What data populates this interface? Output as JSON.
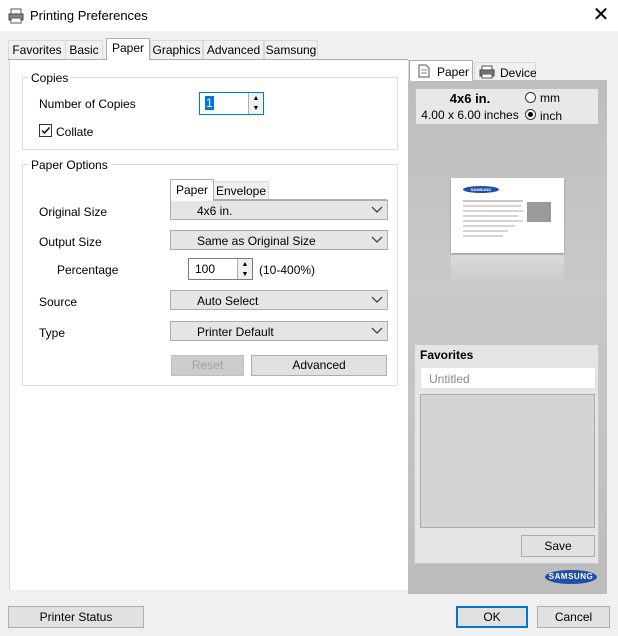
{
  "window": {
    "title": "Printing Preferences"
  },
  "tabs": [
    "Favorites",
    "Basic",
    "Paper",
    "Graphics",
    "Advanced",
    "Samsung"
  ],
  "copies": {
    "legend": "Copies",
    "number_label": "Number of Copies",
    "number_value": "1",
    "collate_label": "Collate",
    "collate_checked": true
  },
  "paper_options": {
    "legend": "Paper Options",
    "subtabs": [
      "Paper",
      "Envelope"
    ],
    "original_size_label": "Original Size",
    "original_size_value": "4x6 in.",
    "output_size_label": "Output Size",
    "output_size_value": "Same as Original Size",
    "percentage_label": "Percentage",
    "percentage_value": "100",
    "percentage_range": "(10-400%)",
    "source_label": "Source",
    "source_value": "Auto Select",
    "type_label": "Type",
    "type_value": "Printer Default",
    "reset_label": "Reset",
    "advanced_label": "Advanced"
  },
  "preview": {
    "tabs": [
      "Paper",
      "Device"
    ],
    "size_name": "4x6 in.",
    "size_dims": "4.00 x 6.00 inches",
    "unit_mm": "mm",
    "unit_inch": "inch",
    "selected_unit": "inch",
    "thumb_brand": "SAMSUNG",
    "favorites_title": "Favorites",
    "favorites_placeholder": "Untitled",
    "save_label": "Save",
    "logo": "SAMSUNG"
  },
  "footer": {
    "printer_status_label": "Printer Status",
    "ok_label": "OK",
    "cancel_label": "Cancel"
  },
  "colors": {
    "accent": "#0078d7",
    "brand": "#1f4fa8"
  }
}
